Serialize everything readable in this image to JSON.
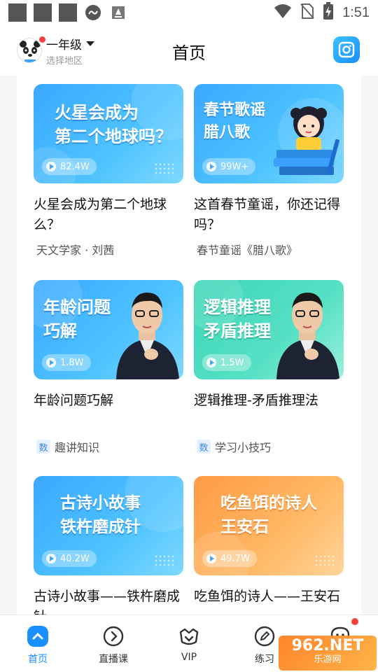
{
  "status_bar": {
    "time": "1:51"
  },
  "header": {
    "grade": "一年级",
    "region": "选择地区",
    "title": "首页"
  },
  "cards": [
    {
      "thumb_title_line1": "火星会成为",
      "thumb_title_line2": "第二个地球吗？",
      "views": "82.4W",
      "title": "火星会成为第二个地球么？",
      "subtitle": "天文学家 · 刘茜",
      "tag": ""
    },
    {
      "thumb_title_line1": "春节歌谣",
      "thumb_title_line2": "腊八歌",
      "views": "99W+",
      "title": "这首春节童谣，你还记得吗？",
      "subtitle": "春节童谣《腊八歌》",
      "tag": ""
    },
    {
      "thumb_title_line1": "年龄问题",
      "thumb_title_line2": "巧解",
      "views": "1.8W",
      "title": "年龄问题巧解",
      "subtitle": "趣讲知识",
      "tag": "数"
    },
    {
      "thumb_title_line1": "逻辑推理",
      "thumb_title_line2": "矛盾推理",
      "views": "1.5W",
      "title": "逻辑推理-矛盾推理法",
      "subtitle": "学习小技巧",
      "tag": "数"
    },
    {
      "thumb_title_line1": "古诗小故事",
      "thumb_title_line2": "铁杵磨成针",
      "views": "40.2W",
      "title": "古诗小故事——铁杵磨成针",
      "subtitle": "",
      "tag": ""
    },
    {
      "thumb_title_line1": "吃鱼饵的诗人",
      "thumb_title_line2": "王安石",
      "views": "49.7W",
      "title": "吃鱼饵的诗人——王安石",
      "subtitle": "",
      "tag": ""
    }
  ],
  "bottom_nav": [
    {
      "label": "首页",
      "icon": "home-icon",
      "active": true
    },
    {
      "label": "直播课",
      "icon": "play-circle-icon",
      "active": false
    },
    {
      "label": "VIP",
      "icon": "vip-crown-icon",
      "active": false
    },
    {
      "label": "练习",
      "icon": "pencil-circle-icon",
      "active": false
    },
    {
      "label": "",
      "icon": "chat-bubble-icon",
      "active": false
    }
  ],
  "watermark": {
    "line1": "962.NET",
    "line2": "乐游网"
  },
  "colors": {
    "accent": "#1a90ff",
    "badge": "#f3423a"
  }
}
